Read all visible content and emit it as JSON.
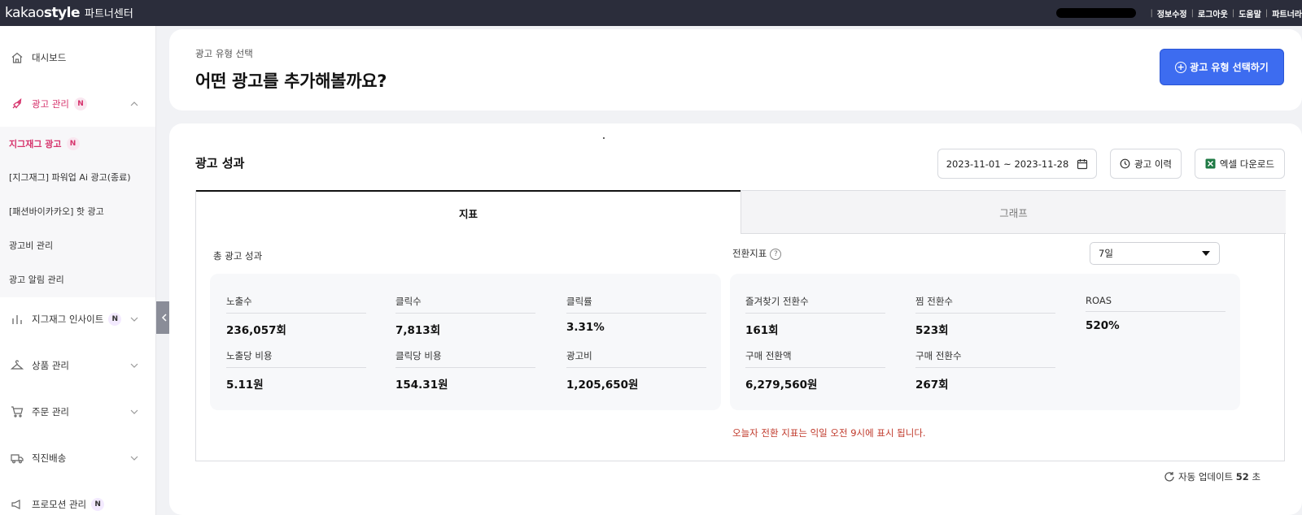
{
  "header": {
    "logo_main_bold": "kakao",
    "logo_main_rest": "style",
    "logo_sub": "파트너센터",
    "links": [
      "정보수정",
      "로그아웃",
      "도움말",
      "파트너라"
    ]
  },
  "sidebar": {
    "items": [
      {
        "label": "대시보드",
        "icon": "home-icon"
      },
      {
        "label": "광고 관리",
        "badge": "N",
        "icon": "rocket-icon",
        "expanded": true
      },
      {
        "label": "지그재그 인사이트",
        "badge": "N",
        "icon": "bar-chart-icon"
      },
      {
        "label": "상품 관리",
        "icon": "hanger-icon"
      },
      {
        "label": "주문 관리",
        "icon": "cart-icon"
      },
      {
        "label": "직진배송",
        "icon": "truck-icon"
      },
      {
        "label": "프로모션 관리",
        "badge": "N",
        "icon": "promotion-icon"
      }
    ],
    "submenu": [
      {
        "label": "지그재그 광고",
        "badge": "N",
        "active": true
      },
      {
        "label": "[지그재그] 파워업 Ai 광고(종료)"
      },
      {
        "label": "[패션바이카카오] 핫 광고"
      },
      {
        "label": "광고비 관리"
      },
      {
        "label": "광고 알림 관리"
      }
    ]
  },
  "top_card": {
    "eyebrow": "광고 유형 선택",
    "headline": "어떤 광고를 추가해볼까요?",
    "button": "광고 유형 선택하기"
  },
  "performance": {
    "title": "광고 성과",
    "date_range": "2023-11-01 ~ 2023-11-28",
    "history_button": "광고 이력",
    "excel_button": "엑셀 다운로드",
    "tabs": [
      "지표",
      "그래프"
    ],
    "total_title": "총 광고 성과",
    "total_stats": [
      {
        "label": "노출수",
        "value": "236,057회"
      },
      {
        "label": "클릭수",
        "value": "7,813회"
      },
      {
        "label": "클릭률",
        "value": "3.31%"
      },
      {
        "label": "노출당 비용",
        "value": "5.11원"
      },
      {
        "label": "클릭당 비용",
        "value": "154.31원"
      },
      {
        "label": "광고비",
        "value": "1,205,650원"
      }
    ],
    "conversion_title": "전환지표",
    "period_select": "7일",
    "conversion_stats": [
      {
        "label": "즐겨찾기 전환수",
        "value": "161회"
      },
      {
        "label": "찜 전환수",
        "value": "523회"
      },
      {
        "label": "ROAS",
        "value": "520%"
      },
      {
        "label": "구매 전환액",
        "value": "6,279,560원"
      },
      {
        "label": "구매 전환수",
        "value": "267회"
      }
    ],
    "notice": "오늘자 전환 지표는 익일 오전 9시에 표시 됩니다.",
    "auto_update_label": "자동 업데이트",
    "auto_update_seconds": "52",
    "auto_update_unit": "초"
  },
  "colors": {
    "topbar": "#2b2d3b",
    "accent_pink": "#d6336c",
    "primary_blue": "#3d6cf0",
    "notice_red": "#c0392b"
  }
}
